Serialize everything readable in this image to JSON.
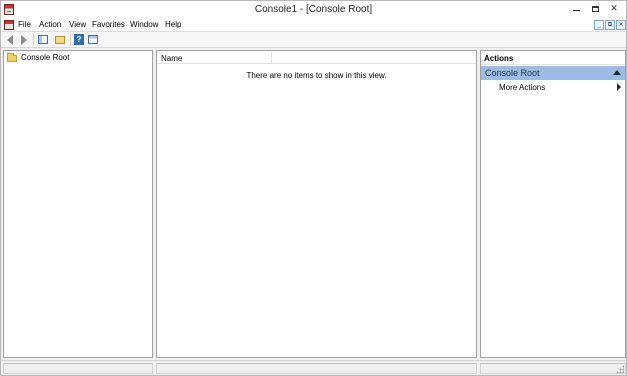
{
  "window": {
    "title": "Console1 - [Console Root]",
    "icon": "mmc-app-icon"
  },
  "menubar": {
    "items": [
      "File",
      "Action",
      "View",
      "Favorites",
      "Window",
      "Help"
    ]
  },
  "toolbar": {
    "buttons": [
      "back-icon",
      "forward-icon",
      "show-hide-console-tree-icon",
      "export-list-icon",
      "help-icon",
      "show-hide-action-pane-icon"
    ]
  },
  "tree": {
    "root_label": "Console Root"
  },
  "list": {
    "column_name": "Name",
    "empty_message": "There are no items to show in this view."
  },
  "actions": {
    "header": "Actions",
    "section_label": "Console Root",
    "items": [
      {
        "label": "More Actions"
      }
    ]
  },
  "colors": {
    "section_highlight": "#9cbde3",
    "folder": "#f4cf62"
  }
}
